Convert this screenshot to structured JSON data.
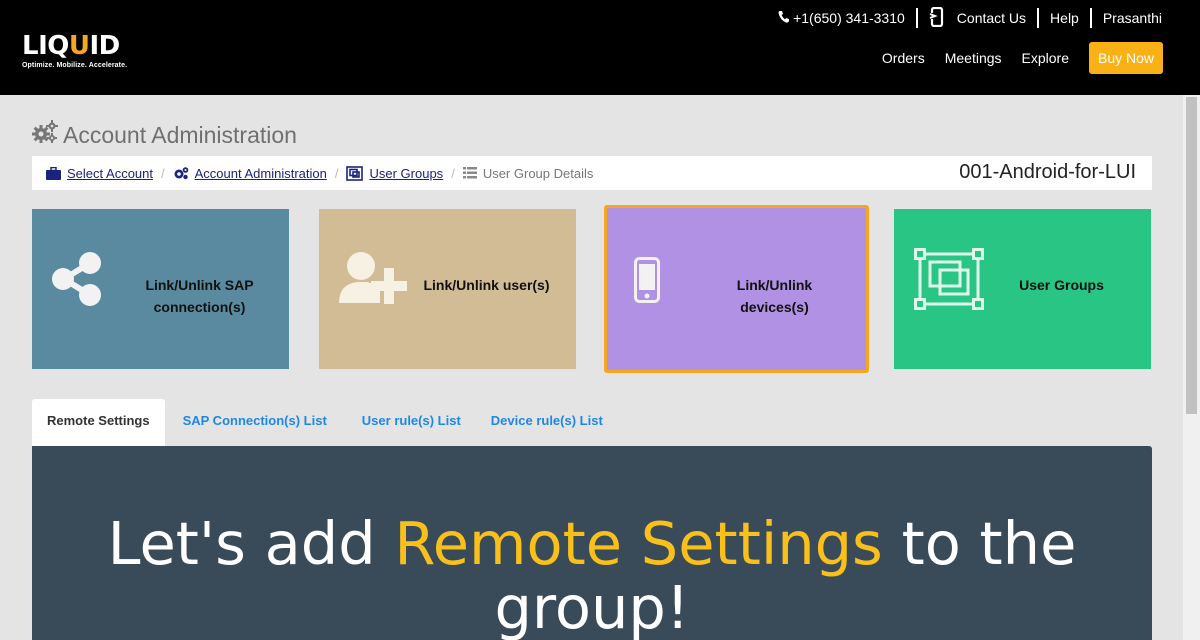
{
  "header": {
    "logo_text": "LIQUID",
    "logo_tagline": "Optimize. Mobilize. Accelerate.",
    "phone": "+1(650) 341-3310",
    "contact": "Contact Us",
    "help": "Help",
    "user": "Prasanthi",
    "nav": [
      "Orders",
      "Meetings",
      "Explore"
    ],
    "buy_now": "Buy Now"
  },
  "page": {
    "title": "Account Administration"
  },
  "breadcrumb": {
    "items": [
      "Select Account",
      "Account Administration",
      "User Groups"
    ],
    "current": "User Group Details",
    "group_name": "001-Android-for-LUI"
  },
  "tiles": [
    {
      "line1": "Link/Unlink SAP",
      "line2": "connection(s)",
      "icon": "share-icon",
      "color": "#5a8a9f"
    },
    {
      "line1": "Link/Unlink user(s)",
      "line2": "",
      "icon": "add-user-icon",
      "color": "#d1bc96"
    },
    {
      "line1": "Link/Unlink",
      "line2": "devices(s)",
      "icon": "mobile-device-icon",
      "color": "#b091e3"
    },
    {
      "line1": "User Groups",
      "line2": "",
      "icon": "user-groups-icon",
      "color": "#29c584"
    }
  ],
  "tabs": [
    "Remote Settings",
    "SAP Connection(s) List",
    "User rule(s) List",
    "Device rule(s) List"
  ],
  "hero": {
    "part1": "Let's add ",
    "highlight": "Remote Settings",
    "part2": " to the group!"
  },
  "colors": {
    "accent": "#f9b115",
    "panel": "#394a58",
    "link": "#1e88e5"
  }
}
